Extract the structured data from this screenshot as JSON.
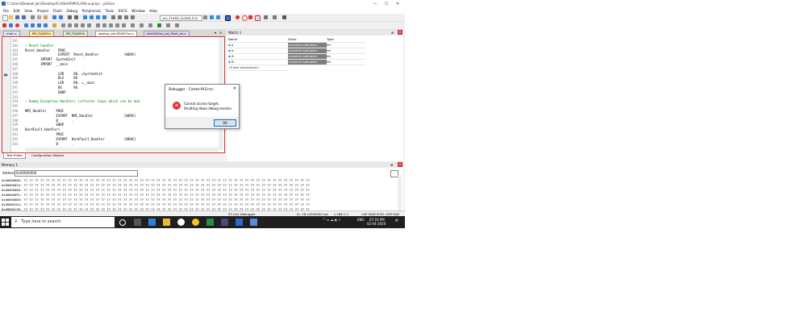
{
  "window": {
    "title": "C:\\Users\\Deepak Jain\\Desktop\\FLASH\\ARM\\FLASH.uvprojx - µVision",
    "controls": [
      "—",
      "☐",
      "✕"
    ]
  },
  "menu": [
    "File",
    "Edit",
    "View",
    "Project",
    "Flash",
    "Debug",
    "Peripherals",
    "Tools",
    "SVCS",
    "Window",
    "Help"
  ],
  "toolbar": {
    "combo_target": "_mc_FLASH_CLEAR_FLA",
    "combo_build": "",
    "debugger_note": ""
  },
  "file_tabs": [
    {
      "label": "main.c",
      "color": "#dde8f5"
    },
    {
      "label": "MY_FLASH.c",
      "color": "#fbe8a0"
    },
    {
      "label": "MY_FLASH.h",
      "color": "#d8efd0"
    },
    {
      "label": "startup_stm32f407xx.s",
      "color": "#f6c7c7"
    },
    {
      "label": "stm32f4xx_hal_flash_ex.c",
      "color": "#e0d7f5"
    }
  ],
  "editor": {
    "lines": [
      {
        "n": "181",
        "t": "",
        "cls": ""
      },
      {
        "n": "182",
        "t": "; Reset handler",
        "cls": "cm"
      },
      {
        "n": "183",
        "t": "Reset_Handler    PROC",
        "cls": ""
      },
      {
        "n": "184",
        "t": "                 EXPORT  Reset_Handler             [WEAK]",
        "cls": ""
      },
      {
        "n": "185",
        "t": "        IMPORT  SystemInit",
        "cls": ""
      },
      {
        "n": "186",
        "t": "        IMPORT  __main",
        "cls": ""
      },
      {
        "n": "187",
        "t": "",
        "cls": ""
      },
      {
        "n": "188",
        "t": "                 LDR     R0, =SystemInit",
        "cls": ""
      },
      {
        "n": "189",
        "t": "                 BLX     R0",
        "cls": ""
      },
      {
        "n": "190",
        "t": "                 LDR     R0, =__main",
        "cls": ""
      },
      {
        "n": "191",
        "t": "                 BX      R0",
        "cls": ""
      },
      {
        "n": "192",
        "t": "                 ENDP",
        "cls": ""
      },
      {
        "n": "193",
        "t": "",
        "cls": ""
      },
      {
        "n": "194",
        "t": "; Dummy Exception Handlers (infinite loops which can be mod",
        "cls": "cm"
      },
      {
        "n": "195",
        "t": "",
        "cls": ""
      },
      {
        "n": "196",
        "t": "NMI_Handler     PROC",
        "cls": ""
      },
      {
        "n": "197",
        "t": "                EXPORT  NMI_Handler                [WEAK]",
        "cls": ""
      },
      {
        "n": "198",
        "t": "                B       .",
        "cls": ""
      },
      {
        "n": "199",
        "t": "                ENDP",
        "cls": ""
      },
      {
        "n": "200",
        "t": "HardFault_Handler\\",
        "cls": ""
      },
      {
        "n": "201",
        "t": "                PROC",
        "cls": ""
      },
      {
        "n": "202",
        "t": "                EXPORT  HardFault_Handler          [WEAK]",
        "cls": ""
      },
      {
        "n": "203",
        "t": "                B       .",
        "cls": ""
      }
    ],
    "bottom_tabs": [
      "Text Editor",
      "Configuration Wizard"
    ]
  },
  "watch": {
    "title": "Watch 1",
    "columns": [
      "Name",
      "Value",
      "Type"
    ],
    "rows": [
      {
        "name": "a",
        "value": "<cannot evaluate>",
        "type": "int"
      },
      {
        "name": "b",
        "value": "<cannot evaluate>",
        "type": "int"
      },
      {
        "name": "A",
        "value": "<cannot evaluate>",
        "type": "int"
      },
      {
        "name": "B",
        "value": "<cannot evaluate>",
        "type": "int"
      }
    ],
    "enter_expression": "<Enter expression>"
  },
  "dialog": {
    "title": "Debugger - Cortex-M Error",
    "line1": "Cannot access target.",
    "line2": "Shutting down debug session.",
    "ok": "OK"
  },
  "memory": {
    "title": "Memory 1",
    "address_label": "Address:",
    "address_value": "0x00000000",
    "rows": [
      "0x00000000: ?? ?? ?? ?? ?? ?? ?? ?? ?? ?? ?? ?? ?? ?? ?? ?? ?? ?? ?? ?? ?? ?? ?? ?? ?? ?? ?? ?? ?? ?? ?? ?? ?? ?? ?? ?? ?? ?? ?? ?? ?? ?? ?? ?? ?? ?? ?? ?? ?? ?? ?? ??",
      "0x00000034: ?? ?? ?? ?? ?? ?? ?? ?? ?? ?? ?? ?? ?? ?? ?? ?? ?? ?? ?? ?? ?? ?? ?? ?? ?? ?? ?? ?? ?? ?? ?? ?? ?? ?? ?? ?? ?? ?? ?? ?? ?? ?? ?? ?? ?? ?? ?? ?? ?? ?? ?? ??",
      "0x00000068: ?? ?? ?? ?? ?? ?? ?? ?? ?? ?? ?? ?? ?? ?? ?? ?? ?? ?? ?? ?? ?? ?? ?? ?? ?? ?? ?? ?? ?? ?? ?? ?? ?? ?? ?? ?? ?? ?? ?? ?? ?? ?? ?? ?? ?? ?? ?? ?? ?? ?? ?? ??",
      "0x0000009C: ?? ?? ?? ?? ?? ?? ?? ?? ?? ?? ?? ?? ?? ?? ?? ?? ?? ?? ?? ?? ?? ?? ?? ?? ?? ?? ?? ?? ?? ?? ?? ?? ?? ?? ?? ?? ?? ?? ?? ?? ?? ?? ?? ?? ?? ?? ?? ?? ?? ?? ?? ??",
      "0x000000D0: ?? ?? ?? ?? ?? ?? ?? ?? ?? ?? ?? ?? ?? ?? ?? ?? ?? ?? ?? ?? ?? ?? ?? ?? ?? ?? ?? ?? ?? ?? ?? ?? ?? ?? ?? ?? ?? ?? ?? ?? ?? ?? ?? ?? ?? ?? ?? ?? ?? ?? ?? ??",
      "0x00000104: ?? ?? ?? ?? ?? ?? ?? ?? ?? ?? ?? ?? ?? ?? ?? ?? ?? ?? ?? ?? ?? ?? ?? ?? ?? ?? ?? ?? ?? ?? ?? ?? ?? ?? ?? ?? ?? ?? ?? ?? ?? ?? ?? ?? ?? ?? ?? ?? ?? ?? ?? ??",
      "0x00000138: ?? ?? ?? ?? ?? ?? ?? ?? ?? ?? ?? ?? ?? ?? ?? ?? ?? ?? ?? ?? ?? ?? ?? ?? ?? ?? ?? ?? ?? ?? ?? ?? ?? ?? ?? ?? ?? ?? ?? ?? ?? ?? ?? ?? ?? ?? ?? ?? ?? ?? ?? ??"
    ]
  },
  "status": {
    "debugger": "ST-Link Debugger",
    "time": "t1: 18.14926300 sec",
    "position": "L:188 C:1",
    "flags": "CAP  NUM  SCRL  OVR  R/W"
  },
  "taskbar": {
    "search_placeholder": "Type here to search",
    "lang": "ENG",
    "time": "07:16 PM",
    "date": "02-04-2020"
  }
}
